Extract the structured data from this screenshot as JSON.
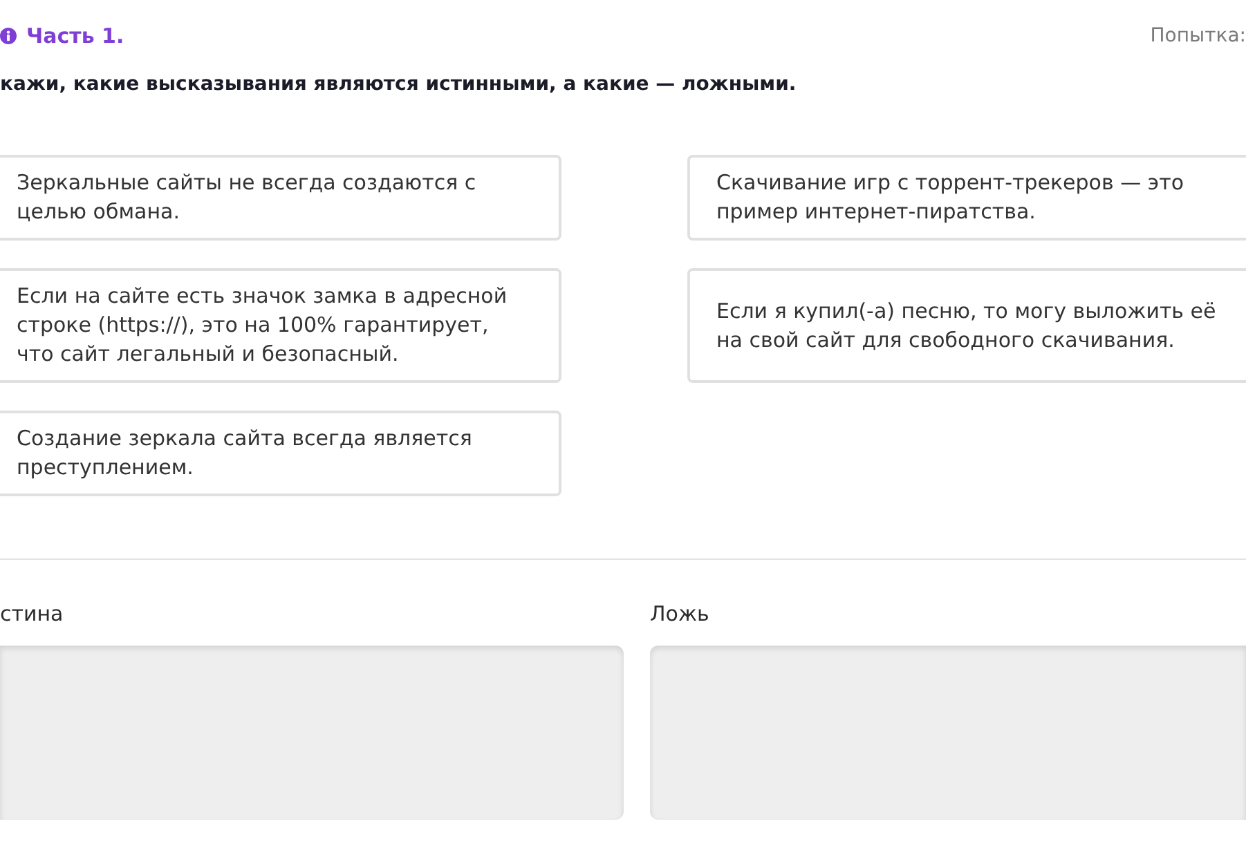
{
  "header": {
    "part_title": "Часть 1.",
    "attempt_label": "Попытка:"
  },
  "instruction": "кажи, какие высказывания являются истинными, а какие — ложными.",
  "statements": [
    {
      "text": "Зеркальные сайты не всегда создаются с целью обмана."
    },
    {
      "text": "Скачивание игр с торрент-трекеров — это пример интернет-пиратства."
    },
    {
      "text": "Если на сайте есть значок замка в адресной строке (https://), это на 100% гарантирует, что сайт легальный и безопасный."
    },
    {
      "text": "Если я купил(-а) песню, то могу выложить её на свой сайт для свободного скачивания."
    },
    {
      "text": "Создание зеркала сайта всегда является преступлением."
    }
  ],
  "categories": [
    {
      "label": "стина"
    },
    {
      "label": "Ложь"
    }
  ]
}
